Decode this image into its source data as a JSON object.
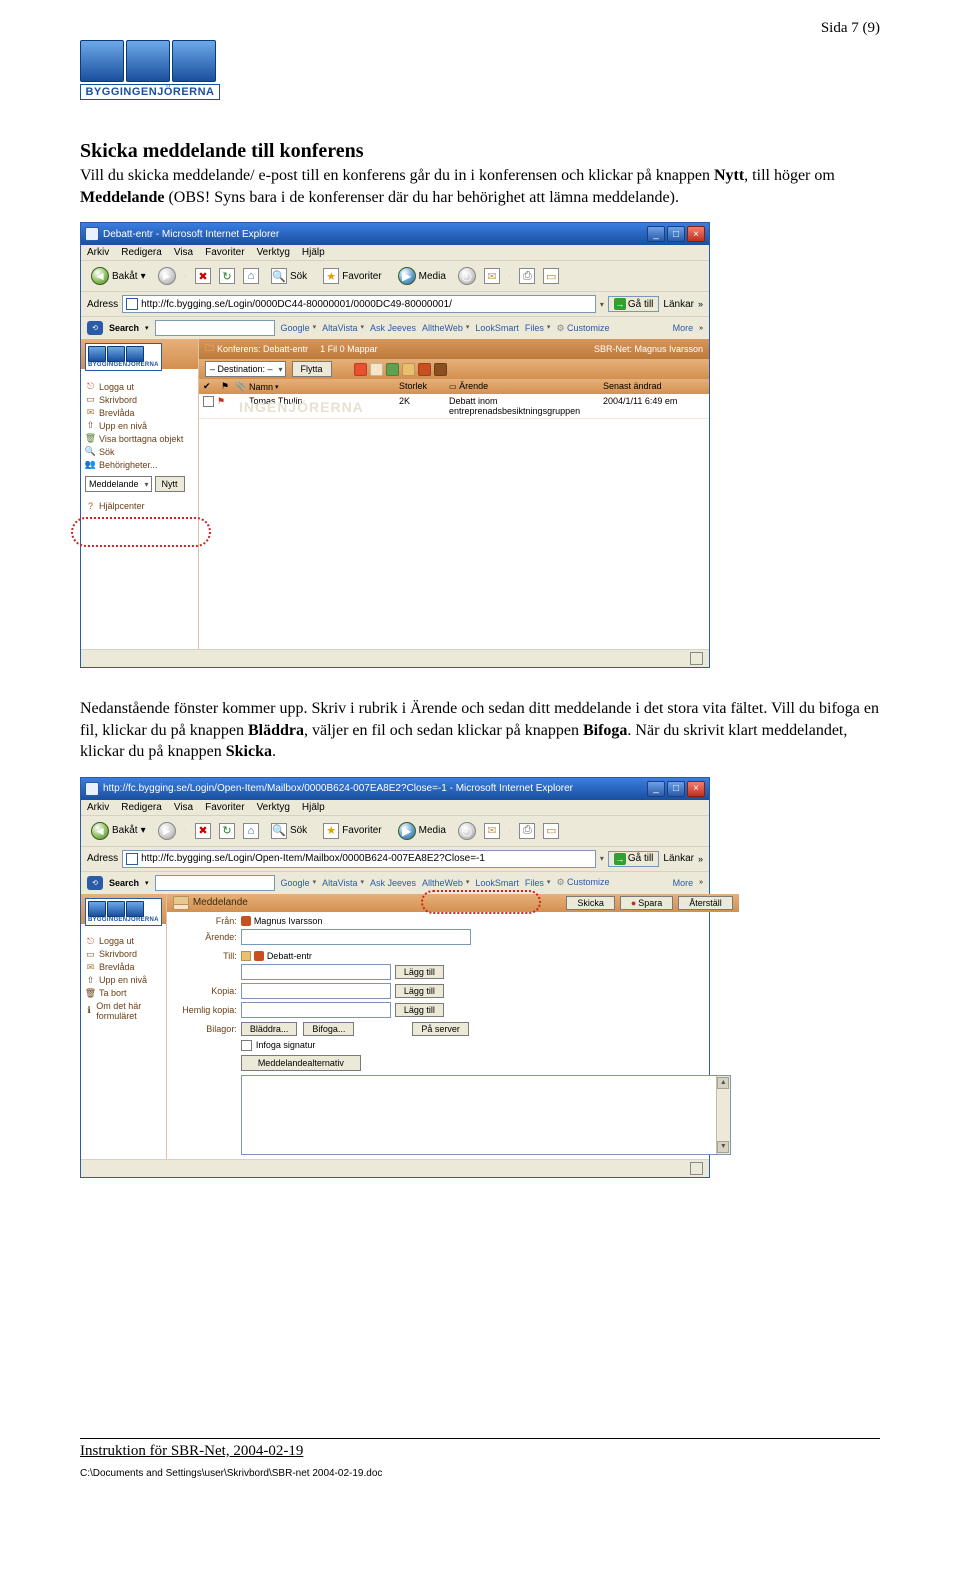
{
  "page_number": "Sida 7 (9)",
  "logo_text": "BYGGINGENJÖRERNA",
  "heading": "Skicka meddelande till konferens",
  "para1_pre": "Vill du skicka meddelande/ e-post till en konferens går du in i konferensen och klickar på knappen ",
  "para1_bold1": "Nytt",
  "para1_mid": ", till höger om ",
  "para1_bold2": "Meddelande",
  "para1_post": " (OBS! Syns bara i de konferenser där du har behörighet att lämna meddelande).",
  "para2_a": "Nedanstående fönster kommer upp. Skriv i rubrik i Ärende och sedan ditt meddelande i det stora vita fältet. Vill du bifoga en fil, klickar du på knappen ",
  "para2_b1": "Bläddra",
  "para2_b": ", väljer en fil och sedan klickar på knappen ",
  "para2_b2": "Bifoga",
  "para2_c": ". När du skrivit klart meddelandet, klickar du på knappen ",
  "para2_b3": "Skicka",
  "para2_d": ".",
  "win1": {
    "title": "Debatt-entr - Microsoft Internet Explorer",
    "menu": [
      "Arkiv",
      "Redigera",
      "Visa",
      "Favoriter",
      "Verktyg",
      "Hjälp"
    ],
    "toolbar": {
      "back": "Bakåt",
      "search": "Sök",
      "favorites": "Favoriter",
      "media": "Media"
    },
    "address_label": "Adress",
    "address": "http://fc.bygging.se/Login/0000DC44-80000001/0000DC49-80000001/",
    "go": "Gå till",
    "lankar": "Länkar",
    "search_label": "Search",
    "search_links": [
      "Google",
      "AltaVista",
      "Ask Jeeves",
      "AlltheWeb",
      "LookSmart",
      "Files"
    ],
    "customize": "Customize",
    "more": "More",
    "orange": {
      "konf": "Konferens: Debatt-entr",
      "fil": "1 Fil 0 Mappar",
      "net": "SBR-Net: Magnus Ivarsson"
    },
    "dest": "– Destination: –",
    "flytta": "Flytta",
    "headers": {
      "name": "Namn",
      "size": "Storlek",
      "subj": "Ärende",
      "date": "Senast ändrad"
    },
    "row": {
      "name": "Tomas Thulin",
      "size": "2K",
      "subj": "Debatt inom entreprenadsbesiktningsgruppen",
      "date": "2004/1/11 6:49 em"
    },
    "side": {
      "logga": "Logga ut",
      "skriv": "Skrivbord",
      "brev": "Brevlåda",
      "upp": "Upp en nivå",
      "visa": "Visa borttagna objekt",
      "sok": "Sök",
      "beh": "Behörigheter...",
      "medd": "Meddelande",
      "nytt": "Nytt",
      "hjalp": "Hjälpcenter"
    },
    "watermark": "INGENJÖRERNA"
  },
  "win2": {
    "title": "http://fc.bygging.se/Login/Open-Item/Mailbox/0000B624-007EA8E2?Close=-1 - Microsoft Internet Explorer",
    "menu": [
      "Arkiv",
      "Redigera",
      "Visa",
      "Favoriter",
      "Verktyg",
      "Hjälp"
    ],
    "toolbar": {
      "back": "Bakåt",
      "search": "Sök",
      "favorites": "Favoriter",
      "media": "Media"
    },
    "address_label": "Adress",
    "address": "http://fc.bygging.se/Login/Open-Item/Mailbox/0000B624-007EA8E2?Close=-1",
    "go": "Gå till",
    "lankar": "Länkar",
    "search_label": "Search",
    "search_links": [
      "Google",
      "AltaVista",
      "Ask Jeeves",
      "AlltheWeb",
      "LookSmart",
      "Files"
    ],
    "customize": "Customize",
    "more": "More",
    "compose": {
      "label": "Meddelande",
      "skicka": "Skicka",
      "spara": "Spara",
      "aterstall": "Återställ"
    },
    "side": {
      "logga": "Logga ut",
      "skriv": "Skrivbord",
      "brev": "Brevlåda",
      "upp": "Upp en nivå",
      "tabort": "Ta bort",
      "om": "Om det här formuläret"
    },
    "form": {
      "fran": "Från:",
      "fran_val": "Magnus Ivarsson",
      "arende": "Ärende:",
      "till": "Till:",
      "till_val": "Debatt-entr",
      "kopia": "Kopia:",
      "hemlig": "Hemlig kopia:",
      "laggtill": "Lägg till",
      "bilagor": "Bilagor:",
      "bladdra": "Bläddra...",
      "bifoga": "Bifoga...",
      "paserver": "På server",
      "infoga": "Infoga signatur",
      "alt": "Meddelandealternativ"
    }
  },
  "footer": {
    "line1": "Instruktion för SBR-Net, 2004-02-19",
    "line2": "C:\\Documents and Settings\\user\\Skrivbord\\SBR-net 2004-02-19.doc"
  }
}
